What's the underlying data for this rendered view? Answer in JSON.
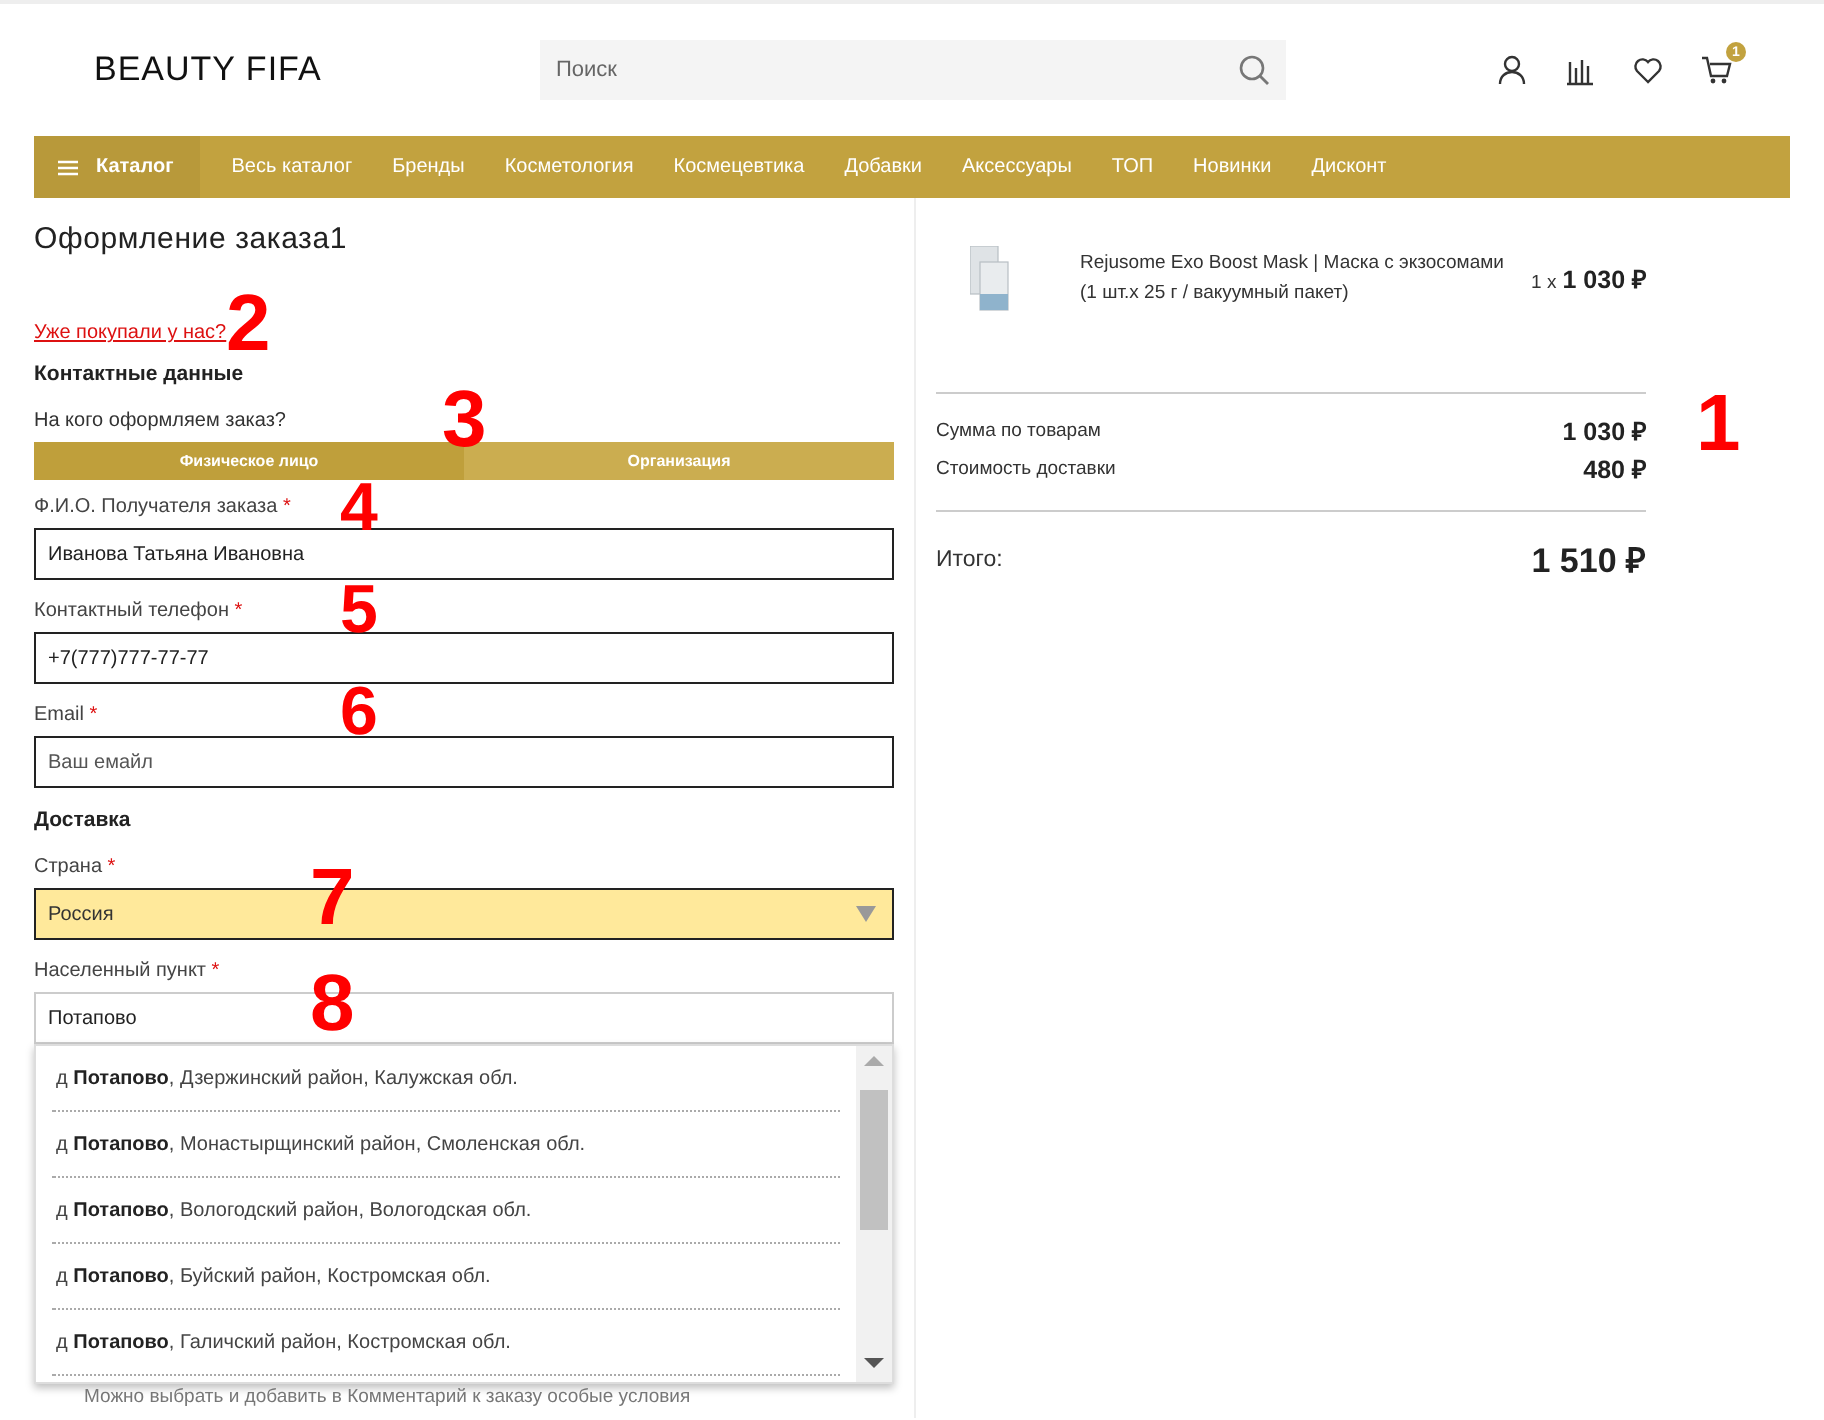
{
  "header": {
    "logo": "BEAUTY FIFA",
    "search": {
      "placeholder": "Поиск"
    },
    "cart_badge": "1"
  },
  "nav": {
    "items": [
      {
        "label": "Каталог",
        "kind": "catalog"
      },
      {
        "label": "Весь каталог",
        "kind": "link"
      },
      {
        "label": "Бренды",
        "kind": "link"
      },
      {
        "label": "Косметология",
        "kind": "link"
      },
      {
        "label": "Космецевтика",
        "kind": "link"
      },
      {
        "label": "Добавки",
        "kind": "link"
      },
      {
        "label": "Аксессуары",
        "kind": "link"
      },
      {
        "label": "ТОП",
        "kind": "link"
      },
      {
        "label": "Новинки",
        "kind": "link"
      },
      {
        "label": "Дисконт",
        "kind": "link"
      }
    ]
  },
  "checkout": {
    "title": "Оформление заказа1",
    "returning_link": "Уже покупали у нас?",
    "contact_heading": "Контактные данные",
    "buyer_question": "На кого оформляем заказ?",
    "buyer_tabs": [
      {
        "label": "Физическое лицо",
        "selected": true
      },
      {
        "label": "Организация",
        "selected": false
      }
    ],
    "contact_fields": [
      {
        "label": "Ф.И.О. Получателя заказа",
        "required_mark": "*",
        "value": "Иванова Татьяна Ивановна"
      },
      {
        "label": "Контактный телефон",
        "required_mark": "*",
        "value": "+7(777)777-77-77"
      },
      {
        "label": "Email",
        "required_mark": "*",
        "placeholder": "Ваш емайл"
      }
    ],
    "delivery_heading": "Доставка",
    "country": {
      "label": "Страна",
      "required_mark": "*",
      "value": "Россия"
    },
    "locality": {
      "label": "Населенный пункт",
      "required_mark": "*",
      "value": "Потапово",
      "suggestions": [
        "д **Потапово**, Дзержинский район, Калужская обл.",
        "д **Потапово**, Монастырщинский район, Смоленская обл.",
        "д **Потапово**, Вологодский район, Вологодская обл.",
        "д **Потапово**, Буйский район, Костромская обл.",
        "д **Потапово**, Галичский район, Костромская обл."
      ]
    },
    "note": "Можно выбрать и добавить в Комментарий к заказу особые условия"
  },
  "summary": {
    "items": [
      {
        "name": "Rejusome Exo Boost Mask | Маска с экзосомами",
        "details": "(1 шт.х 25 г / вакуумный пакет)",
        "quantity": "1 x",
        "price": "1 030 ₽"
      }
    ],
    "lines": [
      {
        "label": "Сумма по товарам",
        "value": "1 030 ₽"
      },
      {
        "label": "Стоимость доставки",
        "value": "480 ₽"
      }
    ],
    "total": {
      "label": "Итого:",
      "value": "1 510 ₽"
    }
  },
  "annotations": [
    {
      "label": "1"
    },
    {
      "label": "2"
    },
    {
      "label": "3"
    },
    {
      "label": "4"
    },
    {
      "label": "5"
    },
    {
      "label": "6"
    },
    {
      "label": "7"
    },
    {
      "label": "8"
    }
  ]
}
